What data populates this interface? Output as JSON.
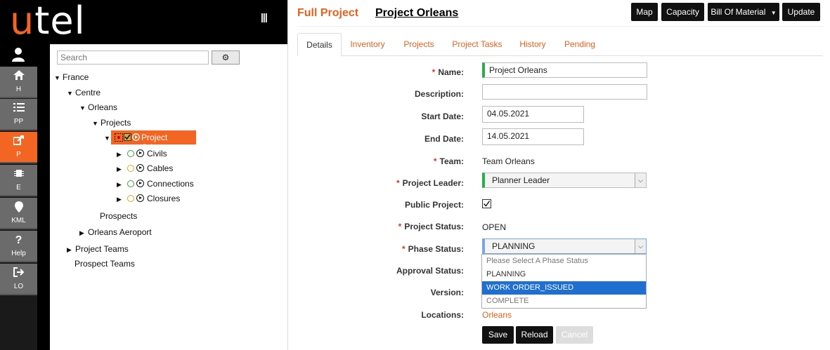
{
  "app": {
    "logo_u": "u",
    "logo_rest": "tel",
    "menu_icon": "|||",
    "accent": "#f26522"
  },
  "rail": [
    {
      "label": "H",
      "icon": "home-icon",
      "active": false
    },
    {
      "label": "PP",
      "icon": "list-icon",
      "active": false
    },
    {
      "label": "P",
      "icon": "share-icon",
      "active": true
    },
    {
      "label": "E",
      "icon": "chip-icon",
      "active": false
    },
    {
      "label": "KML",
      "icon": "pin-icon",
      "active": false
    },
    {
      "label": "Help",
      "icon": "question-icon",
      "active": false
    },
    {
      "label": "LO",
      "icon": "logout-icon",
      "active": false
    }
  ],
  "tree": {
    "search_placeholder": "Search",
    "nodes": {
      "france": "France",
      "centre": "Centre",
      "orleans": "Orleans",
      "projects": "Projects",
      "project_orleans": "Project Orleans",
      "civils": "Civils",
      "cables": "Cables",
      "connections": "Connections",
      "closures": "Closures",
      "prospects": "Prospects",
      "orleans_aeroport": "Orleans Aeroport",
      "project_teams": "Project Teams",
      "prospect_teams": "Prospect Teams"
    }
  },
  "header": {
    "full_project": "Full Project",
    "project_name": "Project Orleans",
    "buttons": {
      "map": "Map",
      "capacity": "Capacity",
      "bom": "Bill Of Material",
      "update": "Update"
    }
  },
  "tabs": [
    "Details",
    "Inventory",
    "Projects",
    "Project Tasks",
    "History",
    "Pending"
  ],
  "form": {
    "name_label": "Name:",
    "name_value": "Project Orleans",
    "description_label": "Description:",
    "description_value": "",
    "start_label": "Start Date:",
    "start_value": "04.05.2021",
    "end_label": "End Date:",
    "end_value": "14.05.2021",
    "team_label": "Team:",
    "team_value": "Team Orleans",
    "leader_label": "Project Leader:",
    "leader_value": "Planner Leader",
    "public_label": "Public Project:",
    "public_checked": true,
    "status_label": "Project Status:",
    "status_value": "OPEN",
    "phase_label": "Phase Status:",
    "phase_value": "PLANNING",
    "approval_label": "Approval Status:",
    "version_label": "Version:",
    "locations_label": "Locations:",
    "locations_value": "Orleans",
    "phase_options": [
      "Please Select A Phase Status",
      "PLANNING",
      "WORK ORDER_ISSUED",
      "COMPLETE"
    ],
    "phase_highlighted": "WORK ORDER_ISSUED"
  },
  "actions": {
    "save": "Save",
    "reload": "Reload",
    "cancel": "Cancel"
  }
}
